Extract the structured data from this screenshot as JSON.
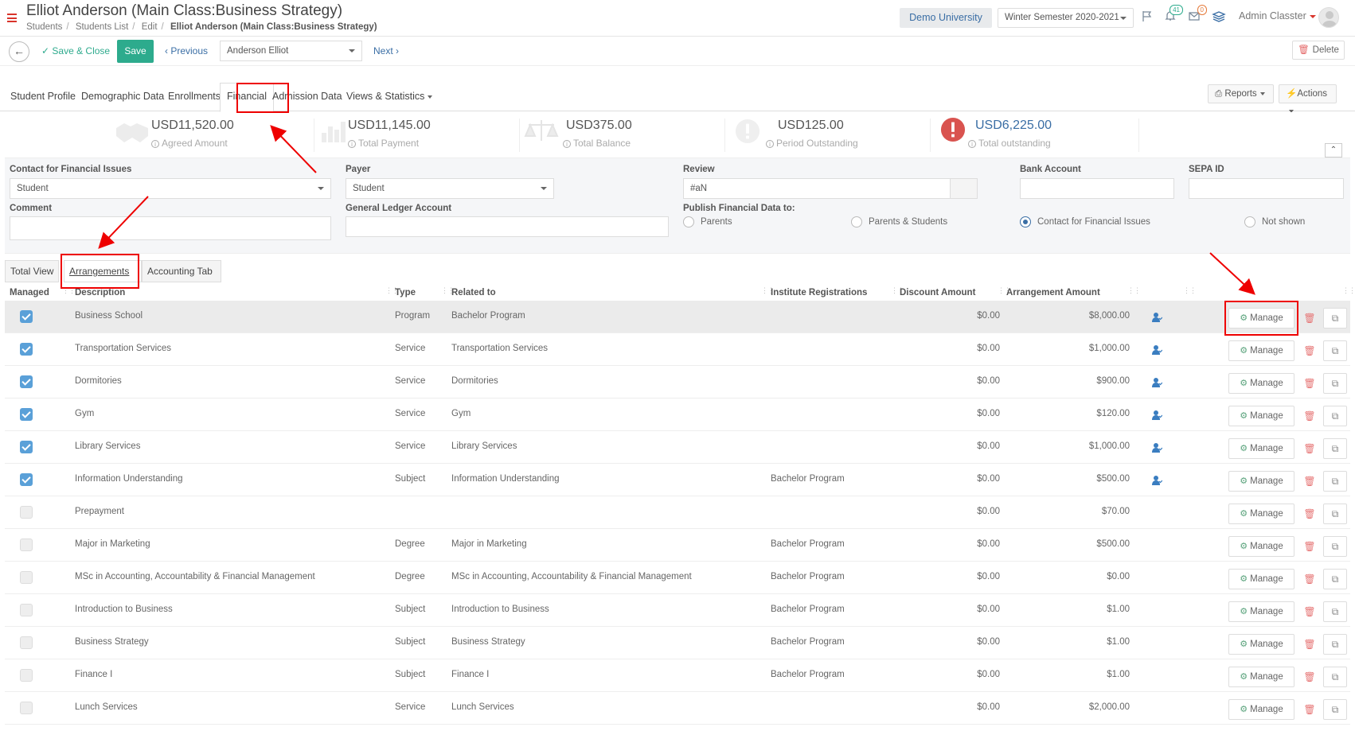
{
  "header": {
    "title": "Elliot Anderson (Main Class:Business Strategy)",
    "breadcrumb": [
      "Students",
      "Students List",
      "Edit"
    ],
    "breadcrumb_current": "Elliot Anderson (Main Class:Business Strategy)",
    "university": "Demo University",
    "semester": "Winter Semester 2020-2021",
    "notifications_count": "41",
    "messages_count": "0",
    "user": "Admin Classter"
  },
  "toolbar": {
    "save_close": "Save & Close",
    "save": "Save",
    "previous": "Previous",
    "student_select": "Anderson Elliot",
    "next": "Next",
    "delete": "Delete"
  },
  "tabs": {
    "items": [
      "Student Profile",
      "Demographic Data",
      "Enrollments",
      "Financial",
      "Admission Data",
      "Views & Statistics"
    ],
    "active": "Financial",
    "reports": "Reports",
    "actions": "Actions"
  },
  "summary": [
    {
      "amount": "USD11,520.00",
      "label": "Agreed Amount"
    },
    {
      "amount": "USD11,145.00",
      "label": "Total Payment"
    },
    {
      "amount": "USD375.00",
      "label": "Total Balance"
    },
    {
      "amount": "USD125.00",
      "label": "Period Outstanding"
    },
    {
      "amount": "USD6,225.00",
      "label": "Total outstanding"
    }
  ],
  "form": {
    "contact_label": "Contact for Financial Issues",
    "contact_value": "Student",
    "payer_label": "Payer",
    "payer_value": "Student",
    "review_label": "Review",
    "review_value": "#aN",
    "bank_label": "Bank Account",
    "bank_value": "",
    "sepa_label": "SEPA ID",
    "sepa_value": "",
    "comment_label": "Comment",
    "comment_value": "",
    "gl_label": "General Ledger Account",
    "gl_value": "",
    "publish_label": "Publish Financial Data to:",
    "publish_options": [
      "Parents",
      "Parents & Students",
      "Contact for Financial Issues",
      "Not shown"
    ],
    "publish_selected": "Contact for Financial Issues"
  },
  "subtabs": {
    "items": [
      "Total View",
      "Arrangements",
      "Accounting Tab"
    ],
    "active": "Arrangements"
  },
  "table": {
    "columns": [
      "Managed",
      "Description",
      "Type",
      "Related to",
      "Institute Registrations",
      "Discount Amount",
      "Arrangement Amount"
    ],
    "manage_label": "Manage",
    "rows": [
      {
        "managed": true,
        "description": "Business School",
        "type": "Program",
        "related": "Bachelor Program",
        "registrations": "",
        "discount": "$0.00",
        "amount": "$8,000.00"
      },
      {
        "managed": true,
        "description": "Transportation Services",
        "type": "Service",
        "related": "Transportation Services",
        "registrations": "",
        "discount": "$0.00",
        "amount": "$1,000.00"
      },
      {
        "managed": true,
        "description": "Dormitories",
        "type": "Service",
        "related": "Dormitories",
        "registrations": "",
        "discount": "$0.00",
        "amount": "$900.00"
      },
      {
        "managed": true,
        "description": "Gym",
        "type": "Service",
        "related": "Gym",
        "registrations": "",
        "discount": "$0.00",
        "amount": "$120.00"
      },
      {
        "managed": true,
        "description": "Library Services",
        "type": "Service",
        "related": "Library Services",
        "registrations": "",
        "discount": "$0.00",
        "amount": "$1,000.00"
      },
      {
        "managed": true,
        "description": "Information Understanding",
        "type": "Subject",
        "related": "Information Understanding",
        "registrations": "Bachelor Program",
        "discount": "$0.00",
        "amount": "$500.00"
      },
      {
        "managed": false,
        "description": "Prepayment",
        "type": "",
        "related": "",
        "registrations": "",
        "discount": "$0.00",
        "amount": "$70.00"
      },
      {
        "managed": false,
        "description": "Major in Marketing",
        "type": "Degree",
        "related": "Major in Marketing",
        "registrations": "Bachelor Program",
        "discount": "$0.00",
        "amount": "$500.00"
      },
      {
        "managed": false,
        "description": "MSc in Accounting, Accountability & Financial Management",
        "type": "Degree",
        "related": "MSc in Accounting, Accountability & Financial Management",
        "registrations": "Bachelor Program",
        "discount": "$0.00",
        "amount": "$0.00"
      },
      {
        "managed": false,
        "description": "Introduction to Business",
        "type": "Subject",
        "related": "Introduction to Business",
        "registrations": "Bachelor Program",
        "discount": "$0.00",
        "amount": "$1.00"
      },
      {
        "managed": false,
        "description": "Business Strategy",
        "type": "Subject",
        "related": "Business Strategy",
        "registrations": "Bachelor Program",
        "discount": "$0.00",
        "amount": "$1.00"
      },
      {
        "managed": false,
        "description": "Finance I",
        "type": "Subject",
        "related": "Finance I",
        "registrations": "Bachelor Program",
        "discount": "$0.00",
        "amount": "$1.00"
      },
      {
        "managed": false,
        "description": "Lunch Services",
        "type": "Service",
        "related": "Lunch Services",
        "registrations": "",
        "discount": "$0.00",
        "amount": "$2,000.00"
      }
    ]
  },
  "colors": {
    "accent_green": "#2dab8d",
    "link_blue": "#3a6ea5",
    "annotation_red": "#ee0000",
    "checkbox_blue": "#5aa0d8"
  }
}
